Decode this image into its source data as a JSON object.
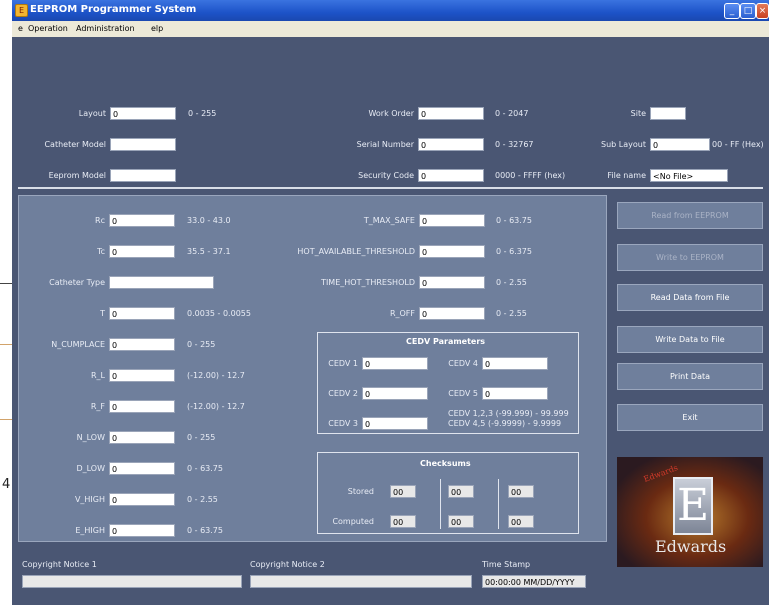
{
  "window": {
    "title": "EEPROM Programmer System",
    "minimize": "_",
    "maximize": "□",
    "close": "×"
  },
  "edge": {
    "left_glyph": "4"
  },
  "menu": [
    "e",
    "Operation",
    "Administration",
    "elp"
  ],
  "header": {
    "layout": {
      "label": "Layout",
      "value": "0",
      "range": "0 - 255"
    },
    "catheter_model": {
      "label": "Catheter Model",
      "value": ""
    },
    "eeprom_model": {
      "label": "Eeprom Model",
      "value": ""
    },
    "work_order": {
      "label": "Work Order",
      "value": "0",
      "range": "0 - 2047"
    },
    "serial_number": {
      "label": "Serial Number",
      "value": "0",
      "range": "0 - 32767"
    },
    "security_code": {
      "label": "Security Code",
      "value": "0",
      "range": "0000 - FFFF (hex)"
    },
    "site": {
      "label": "Site",
      "value": ""
    },
    "sub_layout": {
      "label": "Sub Layout",
      "value": "0",
      "range": "00 - FF (Hex)"
    },
    "file_name": {
      "label": "File name",
      "value": "<No File>"
    }
  },
  "params_left": [
    {
      "label": "Rc",
      "value": "0",
      "range": "33.0 - 43.0"
    },
    {
      "label": "Tc",
      "value": "0",
      "range": "35.5 - 37.1"
    },
    {
      "label": "Catheter Type",
      "value": "",
      "range": ""
    },
    {
      "label": "T",
      "value": "0",
      "range": "0.0035 - 0.0055"
    },
    {
      "label": "N_CUMPLACE",
      "value": "0",
      "range": "0 - 255"
    },
    {
      "label": "R_L",
      "value": "0",
      "range": "(-12.00) - 12.7"
    },
    {
      "label": "R_F",
      "value": "0",
      "range": "(-12.00) - 12.7"
    },
    {
      "label": "N_LOW",
      "value": "0",
      "range": "0 - 255"
    },
    {
      "label": "D_LOW",
      "value": "0",
      "range": "0 - 63.75"
    },
    {
      "label": "V_HIGH",
      "value": "0",
      "range": "0 - 2.55"
    },
    {
      "label": "E_HIGH",
      "value": "0",
      "range": "0 - 63.75"
    }
  ],
  "params_mid": [
    {
      "label": "T_MAX_SAFE",
      "value": "0",
      "range": "0 - 63.75"
    },
    {
      "label": "HOT_AVAILABLE_THRESHOLD",
      "value": "0",
      "range": "0 - 6.375"
    },
    {
      "label": "TIME_HOT_THRESHOLD",
      "value": "0",
      "range": "0 - 2.55"
    },
    {
      "label": "R_OFF",
      "value": "0",
      "range": "0 - 2.55"
    }
  ],
  "cedv": {
    "title": "CEDV Parameters",
    "fields": [
      {
        "label": "CEDV 1",
        "value": "0"
      },
      {
        "label": "CEDV 4",
        "value": "0"
      },
      {
        "label": "CEDV 2",
        "value": "0"
      },
      {
        "label": "CEDV 5",
        "value": "0"
      },
      {
        "label": "CEDV 3",
        "value": "0"
      }
    ],
    "note1": "CEDV 1,2,3 (-99.999) - 99.999",
    "note2": "CEDV 4,5 (-9.9999) - 9.9999"
  },
  "checksums": {
    "title": "Checksums",
    "stored_label": "Stored",
    "computed_label": "Computed",
    "stored": [
      "00",
      "00",
      "00"
    ],
    "computed": [
      "00",
      "00",
      "00"
    ]
  },
  "actions": [
    {
      "label": "Read from EEPROM",
      "enabled": false
    },
    {
      "label": "Write to EEPROM",
      "enabled": false
    },
    {
      "label": "Read Data from File",
      "enabled": true
    },
    {
      "label": "Write Data to File",
      "enabled": true
    },
    {
      "label": "Print Data",
      "enabled": true
    },
    {
      "label": "Exit",
      "enabled": true
    }
  ],
  "logo": {
    "brand": "Edwards",
    "letter": "E",
    "signature": "Edwards"
  },
  "footer": {
    "copyright1": {
      "label": "Copyright Notice 1",
      "value": ""
    },
    "copyright2": {
      "label": "Copyright Notice 2",
      "value": ""
    },
    "timestamp": {
      "label": "Time Stamp",
      "value": "00:00:00 MM/DD/YYYY"
    }
  },
  "colors": {
    "window_bg": "#4a5673",
    "panel_bg": "#6f7f9c",
    "title_blue": "#1d53c8",
    "menu_bg": "#ece9d8"
  }
}
